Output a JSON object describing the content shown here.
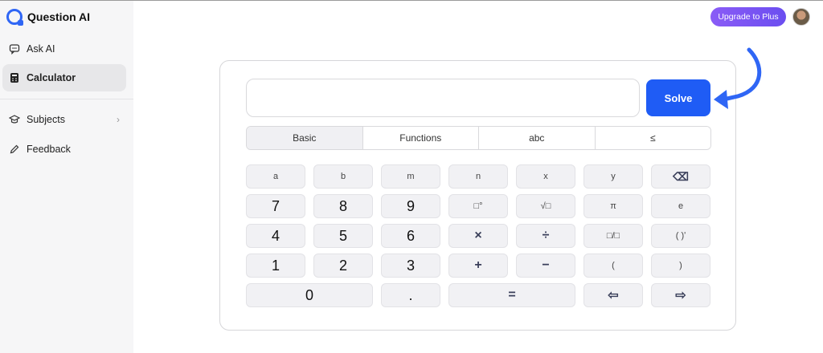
{
  "app": {
    "name": "Question AI"
  },
  "sidebar": {
    "items": [
      {
        "label": "Ask AI",
        "icon": "chat-bubble-icon"
      },
      {
        "label": "Calculator",
        "icon": "calculator-icon",
        "active": true
      },
      {
        "label": "Subjects",
        "icon": "graduation-cap-icon",
        "has_chevron": true
      },
      {
        "label": "Feedback",
        "icon": "pencil-icon"
      }
    ]
  },
  "header": {
    "upgrade_label": "Upgrade to Plus"
  },
  "calculator": {
    "input_value": "",
    "solve_label": "Solve",
    "tabs": [
      {
        "label": "Basic",
        "active": true
      },
      {
        "label": "Functions"
      },
      {
        "label": "abc"
      },
      {
        "label": "≤"
      }
    ],
    "keys": {
      "row1": [
        "a",
        "b",
        "m",
        "n",
        "x",
        "y",
        "⌫"
      ],
      "row2": [
        "7",
        "8",
        "9",
        "□°",
        "√□",
        "π",
        "e"
      ],
      "row3": [
        "4",
        "5",
        "6",
        "×",
        "÷",
        "□/□",
        "( )ʹ"
      ],
      "row4": [
        "1",
        "2",
        "3",
        "+",
        "−",
        "(",
        ")"
      ],
      "row5": [
        "0",
        ".",
        "=",
        "⇦",
        "⇨"
      ]
    }
  },
  "colors": {
    "accent": "#1f5cf5",
    "upgrade_start": "#8a5cf6",
    "upgrade_end": "#6b4ef0"
  }
}
